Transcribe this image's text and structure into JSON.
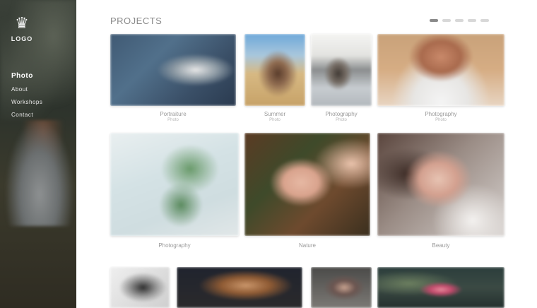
{
  "sidebar": {
    "logo": {
      "icon": "heart-crown-icon",
      "wordmark": "LOGO"
    },
    "nav": [
      {
        "label": "Photo",
        "active": true
      },
      {
        "label": "About",
        "active": false
      },
      {
        "label": "Workshops",
        "active": false
      },
      {
        "label": "Contact",
        "active": false
      }
    ]
  },
  "header": {
    "title": "PROJECTS"
  },
  "pager": {
    "count": 5,
    "current": 1
  },
  "photos": [
    {
      "icon": "portrait-photo-icon",
      "caption": "Portraiture",
      "sub": "Photo"
    },
    {
      "icon": "portrait-photo-icon",
      "caption": "Summer",
      "sub": "Photo"
    },
    {
      "icon": "portrait-photo-icon",
      "caption": "Photography",
      "sub": "Photo"
    },
    {
      "icon": "portrait-photo-icon",
      "caption": "Photography",
      "sub": "Photo"
    },
    {
      "icon": "portrait-photo-icon",
      "caption": "Photography",
      "sub": ""
    },
    {
      "icon": "portrait-photo-icon",
      "caption": "Nature",
      "sub": ""
    },
    {
      "icon": "portrait-photo-icon",
      "caption": "Beauty",
      "sub": ""
    },
    {
      "icon": "portrait-photo-icon",
      "caption": "",
      "sub": ""
    },
    {
      "icon": "portrait-photo-icon",
      "caption": "",
      "sub": ""
    },
    {
      "icon": "portrait-photo-icon",
      "caption": "",
      "sub": ""
    },
    {
      "icon": "portrait-photo-icon",
      "caption": "",
      "sub": ""
    }
  ]
}
